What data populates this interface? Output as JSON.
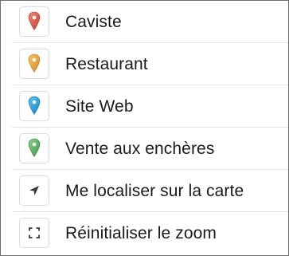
{
  "menu": {
    "items": [
      {
        "label": "Caviste",
        "icon": "map-pin-icon",
        "color": "#d9534f"
      },
      {
        "label": "Restaurant",
        "icon": "map-pin-icon",
        "color": "#e8a33a"
      },
      {
        "label": "Site Web",
        "icon": "map-pin-icon",
        "color": "#1e9fd8"
      },
      {
        "label": "Vente aux enchères",
        "icon": "map-pin-icon",
        "color": "#4caf50"
      },
      {
        "label": "Me localiser sur la carte",
        "icon": "location-arrow-icon",
        "color": "#333333"
      },
      {
        "label": "Réinitialiser le zoom",
        "icon": "fullscreen-corners-icon",
        "color": "#333333"
      }
    ]
  }
}
